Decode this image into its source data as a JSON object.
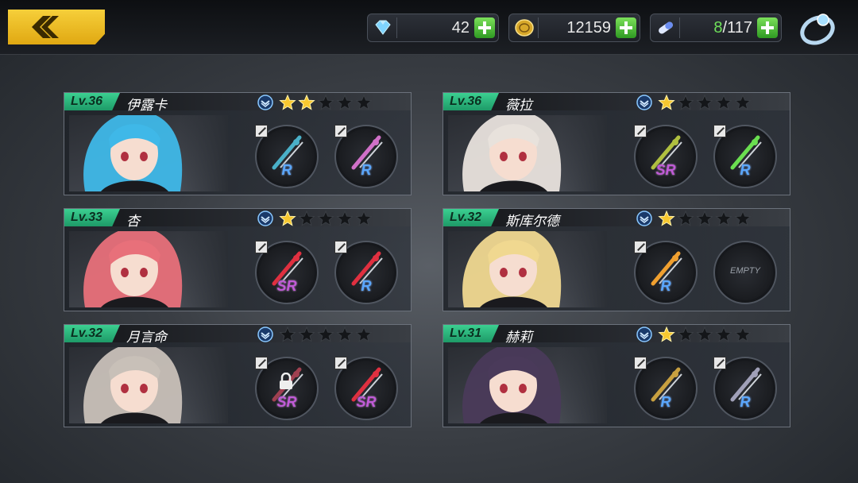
{
  "currencies": [
    {
      "name": "diamond",
      "icon": "diamond-icon",
      "value": "42"
    },
    {
      "name": "gold",
      "icon": "gold-coin-icon",
      "value": "12159"
    },
    {
      "name": "stamina",
      "icon": "stamina-capsule-icon",
      "current": "8",
      "max": "/117"
    }
  ],
  "characters": [
    {
      "level": "Lv.36",
      "name": "伊露卡",
      "stars": 2,
      "hair": "#3fb8e8",
      "weapons": [
        {
          "rarity": "R",
          "color": "#4ab0c8"
        },
        {
          "rarity": "R",
          "color": "#d070c8"
        }
      ]
    },
    {
      "level": "Lv.36",
      "name": "薇拉",
      "stars": 1,
      "hair": "#e8e2dc",
      "weapons": [
        {
          "rarity": "SR",
          "color": "#b0c040"
        },
        {
          "rarity": "R",
          "color": "#6adf50"
        }
      ]
    },
    {
      "level": "Lv.33",
      "name": "杏",
      "stars": 1,
      "hair": "#e8707a",
      "weapons": [
        {
          "rarity": "SR",
          "color": "#e03040"
        },
        {
          "rarity": "R",
          "color": "#e03040"
        }
      ]
    },
    {
      "level": "Lv.32",
      "name": "斯库尔德",
      "stars": 1,
      "hair": "#f0d890",
      "weapons": [
        {
          "rarity": "R",
          "color": "#f0a030"
        },
        {
          "rarity": "EMPTY",
          "color": "#555"
        }
      ]
    },
    {
      "level": "Lv.32",
      "name": "月言命",
      "stars": 0,
      "hair": "#c8c0b8",
      "weapons": [
        {
          "rarity": "SR",
          "color": "#a04050",
          "locked": true
        },
        {
          "rarity": "SR",
          "color": "#e03040"
        }
      ]
    },
    {
      "level": "Lv.31",
      "name": "赫莉",
      "stars": 1,
      "hair": "#4a3a5a",
      "weapons": [
        {
          "rarity": "R",
          "color": "#c8a040"
        },
        {
          "rarity": "R",
          "color": "#a0a0b8"
        }
      ]
    }
  ],
  "empty_label": "EMPTY"
}
